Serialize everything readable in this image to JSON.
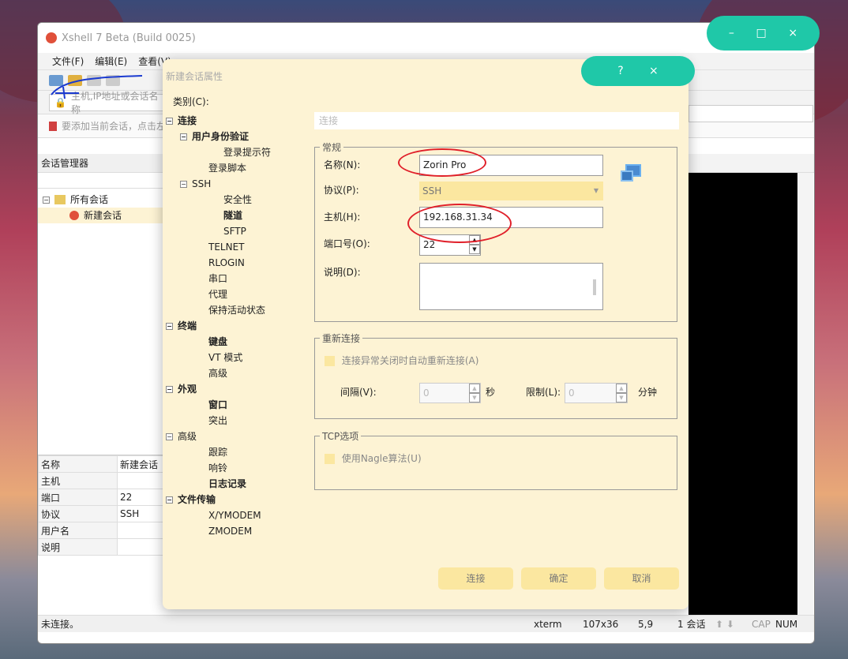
{
  "app": {
    "title": "Xshell 7 Beta (Build 0025)",
    "menu": [
      "文件(F)",
      "编辑(E)",
      "查看(V)"
    ],
    "address_placeholder": "主机,IP地址或会话名称",
    "hint": "要添加当前会话，点击左",
    "window_controls": [
      "–",
      "□",
      "×"
    ]
  },
  "session_manager": {
    "title": "会话管理器",
    "tree": [
      {
        "label": "所有会话",
        "children": [
          {
            "label": "新建会话"
          }
        ]
      }
    ]
  },
  "properties": {
    "rows": [
      {
        "key": "名称",
        "value": "新建会话"
      },
      {
        "key": "主机",
        "value": ""
      },
      {
        "key": "端口",
        "value": "22"
      },
      {
        "key": "协议",
        "value": "SSH"
      },
      {
        "key": "用户名",
        "value": ""
      },
      {
        "key": "说明",
        "value": ""
      }
    ]
  },
  "status_bar": {
    "left": "未连接。",
    "term": "xterm",
    "size": "107x36",
    "pos": "5,9",
    "sessions": "1 会话",
    "cap": "CAP",
    "num": "NUM"
  },
  "dialog": {
    "title": "新建会话属性",
    "controls": [
      "?",
      "×"
    ],
    "category_label": "类别(C):",
    "header": "连接",
    "tree": [
      {
        "label": "连接",
        "bold": true,
        "level": 0,
        "exp": "−"
      },
      {
        "label": "用户身份验证",
        "bold": true,
        "level": 1,
        "exp": "−"
      },
      {
        "label": "登录提示符",
        "level": 2
      },
      {
        "label": "登录脚本",
        "level": 1
      },
      {
        "label": "SSH",
        "level": 1,
        "exp": "−"
      },
      {
        "label": "安全性",
        "level": 2
      },
      {
        "label": "隧道",
        "bold": true,
        "level": 2
      },
      {
        "label": "SFTP",
        "level": 2
      },
      {
        "label": "TELNET",
        "level": 1
      },
      {
        "label": "RLOGIN",
        "level": 1
      },
      {
        "label": "串口",
        "level": 1
      },
      {
        "label": "代理",
        "level": 1
      },
      {
        "label": "保持活动状态",
        "level": 1
      },
      {
        "label": "终端",
        "bold": true,
        "level": 0,
        "exp": "−"
      },
      {
        "label": "键盘",
        "bold": true,
        "level": 1
      },
      {
        "label": "VT 模式",
        "level": 1
      },
      {
        "label": "高级",
        "level": 1
      },
      {
        "label": "外观",
        "bold": true,
        "level": 0,
        "exp": "−"
      },
      {
        "label": "窗口",
        "bold": true,
        "level": 1
      },
      {
        "label": "突出",
        "level": 1
      },
      {
        "label": "高级",
        "level": 0,
        "exp": "−"
      },
      {
        "label": "跟踪",
        "level": 1
      },
      {
        "label": "响铃",
        "level": 1
      },
      {
        "label": "日志记录",
        "bold": true,
        "level": 1
      },
      {
        "label": "文件传输",
        "bold": true,
        "level": 0,
        "exp": "−"
      },
      {
        "label": "X/YMODEM",
        "level": 1
      },
      {
        "label": "ZMODEM",
        "level": 1
      }
    ],
    "general": {
      "legend": "常规",
      "name_label": "名称(N):",
      "name_value": "Zorin Pro",
      "protocol_label": "协议(P):",
      "protocol_value": "SSH",
      "host_label": "主机(H):",
      "host_value": "192.168.31.34",
      "port_label": "端口号(O):",
      "port_value": "22",
      "desc_label": "说明(D):"
    },
    "reconnect": {
      "legend": "重新连接",
      "checkbox": "连接异常关闭时自动重新连接(A)",
      "interval_label": "间隔(V):",
      "interval_value": "0",
      "interval_unit": "秒",
      "limit_label": "限制(L):",
      "limit_value": "0",
      "limit_unit": "分钟"
    },
    "tcp": {
      "legend": "TCP选项",
      "checkbox": "使用Nagle算法(U)"
    },
    "buttons": {
      "connect": "连接",
      "ok": "确定",
      "cancel": "取消"
    }
  },
  "colors": {
    "dialog_bg": "#fdf3d4",
    "accent_control": "#1fc8a8",
    "disabled_fill": "#fbe7a0",
    "annotation_red": "#e0202a"
  }
}
